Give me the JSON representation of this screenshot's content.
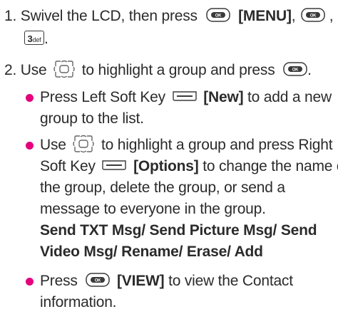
{
  "steps": [
    {
      "number": "1.",
      "lines": [
        {
          "before": "Swivel the LCD, then press",
          "key1_label": "[MENU]",
          "after": ","
        },
        {
          "key3_main": "3",
          "key3_sub": "def",
          "after": "."
        }
      ]
    },
    {
      "number": "2.",
      "lines": [
        {
          "before": "Use",
          "middle": "to highlight a group and press",
          "after": "."
        }
      ]
    }
  ],
  "bullets": [
    {
      "lines": [
        {
          "before": "Press Left Soft Key",
          "label": "[New]",
          "after": "to add a new"
        },
        {
          "text": "group to the list."
        }
      ]
    },
    {
      "lines": [
        {
          "before": "Use",
          "after": "to highlight a group and press Right"
        },
        {
          "before": "Soft Key",
          "label": "[Options]",
          "after": "to change the name of"
        },
        {
          "text": "the group, delete the group, or send a"
        },
        {
          "text": "message to everyone in the group."
        },
        {
          "bold": "Send TXT Msg/ Send Picture Msg/ Send"
        },
        {
          "bold": "Video Msg/ Rename/ Erase/ Add"
        }
      ]
    },
    {
      "lines": [
        {
          "before": "Press",
          "label": "[VIEW]",
          "after": "to view the Contact"
        },
        {
          "text": "information."
        }
      ]
    }
  ],
  "keys": {
    "ok_text": "OK"
  },
  "colors": {
    "bullet": "#e4007c",
    "text": "#2b2b2b"
  },
  "icons": [
    "ok-key-icon",
    "number-3-key-icon",
    "navigation-key-icon",
    "soft-key-left-icon",
    "soft-key-right-icon"
  ]
}
